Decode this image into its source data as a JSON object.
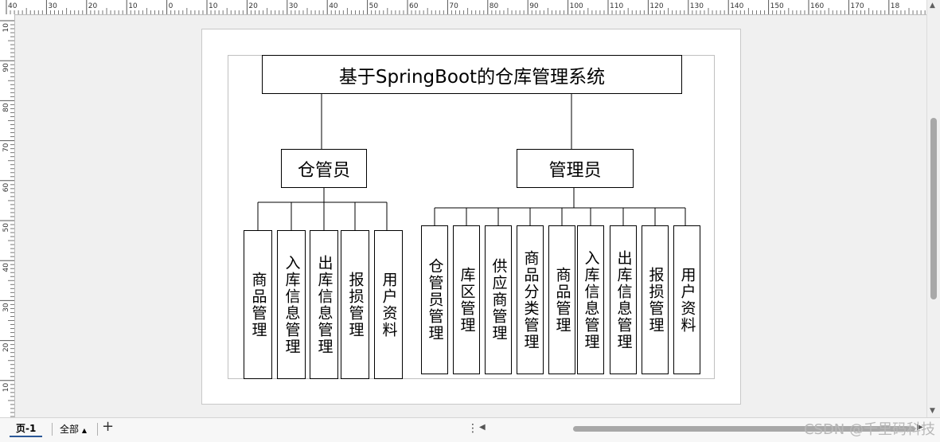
{
  "ruler_top_labels": [
    "40",
    "30",
    "20",
    "10",
    "0",
    "10",
    "20",
    "30",
    "40",
    "50",
    "60",
    "70",
    "80",
    "90",
    "100",
    "110",
    "120",
    "130",
    "140",
    "150",
    "160",
    "170",
    "18"
  ],
  "ruler_left_labels": [
    "10",
    "90",
    "80",
    "70",
    "60",
    "50",
    "40",
    "30",
    "20",
    "10",
    "0"
  ],
  "diagram": {
    "title": "基于SpringBoot的仓库管理系统",
    "roles": [
      {
        "name": "仓管员",
        "modules": [
          "商品管理",
          "入库信息管理",
          "出库信息管理",
          "报损管理",
          "用户资料"
        ]
      },
      {
        "name": "管理员",
        "modules": [
          "仓管员管理",
          "库区管理",
          "供应商管理",
          "商品分类管理",
          "商品管理",
          "入库信息管理",
          "出库信息管理",
          "报损管理",
          "用户资料"
        ]
      }
    ]
  },
  "statusbar": {
    "page_tab": "页-1",
    "all_tab": "全部",
    "add_page_icon": "plus-icon",
    "more_icon": "vertical-ellipsis-icon"
  },
  "watermark": "CSDN @千里码科技"
}
